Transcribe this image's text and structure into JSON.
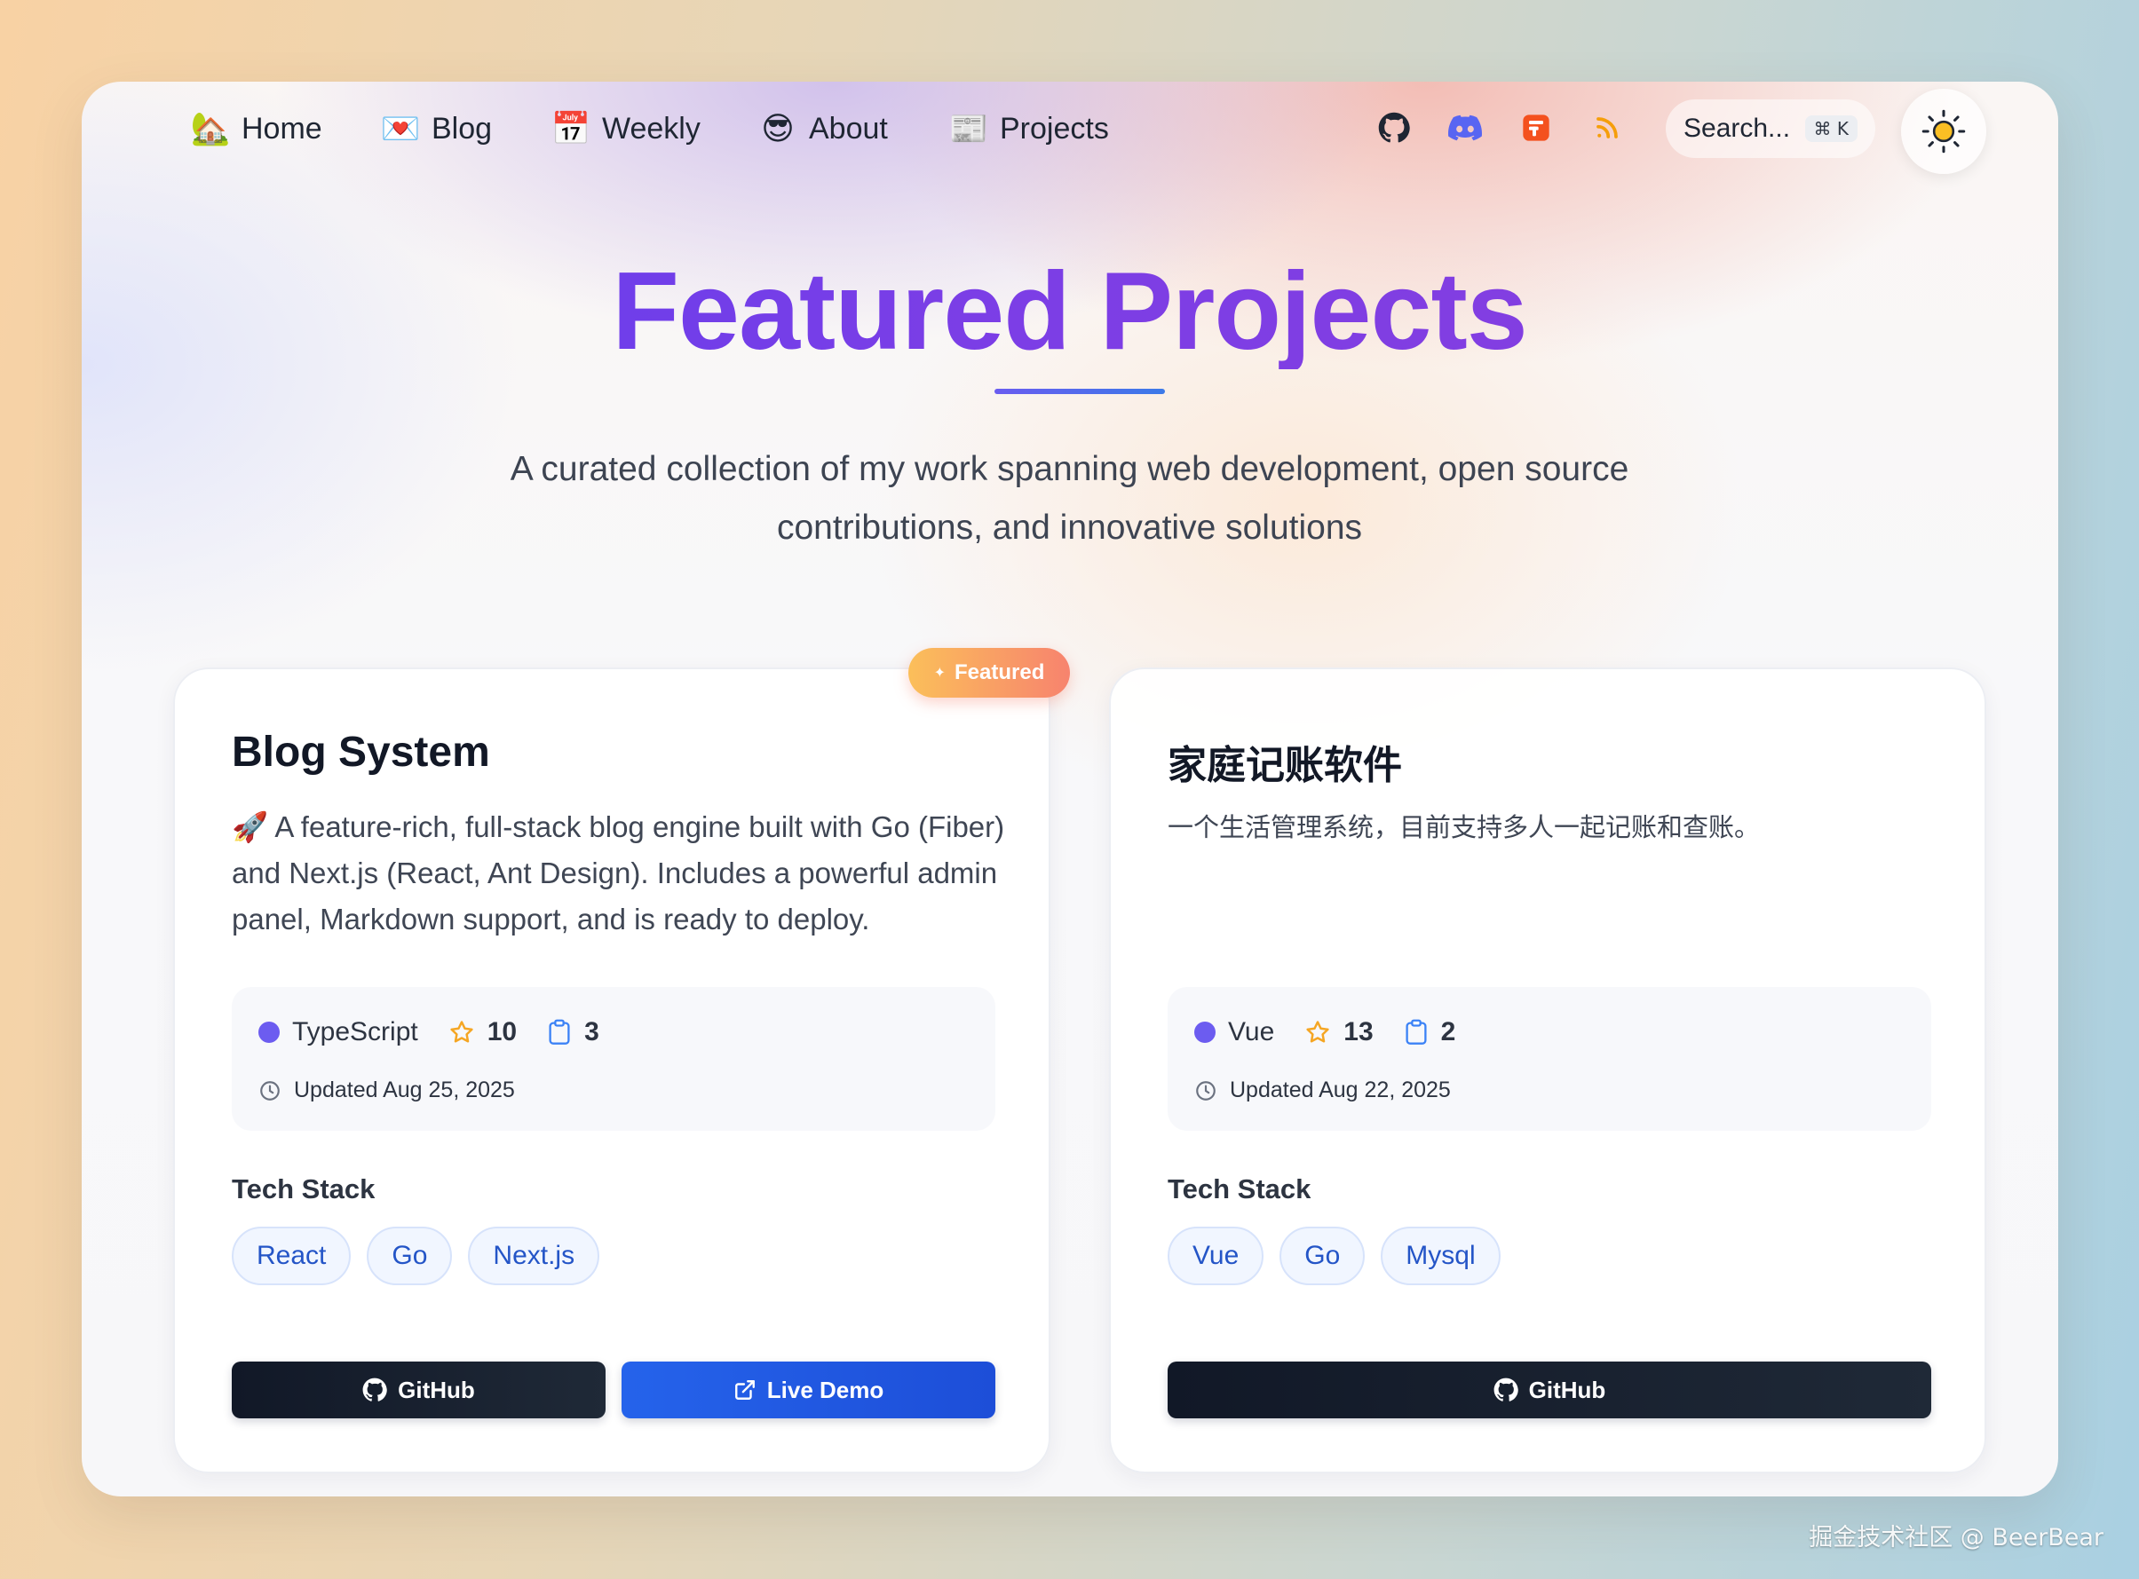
{
  "nav": {
    "items": [
      {
        "emoji": "🏡",
        "label": "Home",
        "icon": "house-icon"
      },
      {
        "emoji": "💌",
        "label": "Blog",
        "icon": "love-letter-icon"
      },
      {
        "emoji": "📅",
        "label": "Weekly",
        "icon": "calendar-icon"
      },
      {
        "emoji": "😎",
        "label": "About",
        "icon": "sunglasses-face-icon"
      },
      {
        "emoji": "📰",
        "label": "Projects",
        "icon": "newspaper-icon"
      }
    ],
    "social": [
      "github-icon",
      "discord-icon",
      "brand-icon",
      "rss-icon"
    ],
    "search_label": "Search...",
    "search_shortcut": "⌘ K",
    "theme_icon": "sun-icon"
  },
  "hero": {
    "title": "Featured Projects",
    "subtitle_line1": "A curated collection of my work spanning web development, open source",
    "subtitle_line2": "contributions, and innovative solutions"
  },
  "featured_badge": "Featured",
  "projects": [
    {
      "title": "Blog System",
      "description": "🚀 A feature-rich, full-stack blog engine built with Go (Fiber) and Next.js (React, Ant Design). Includes a powerful admin panel, Markdown support, and is ready to deploy.",
      "language": "TypeScript",
      "stars": "10",
      "forks": "3",
      "updated": "Updated Aug 25, 2025",
      "tech_label": "Tech Stack",
      "tags": [
        "React",
        "Go",
        "Next.js"
      ],
      "github_label": "GitHub",
      "demo_label": "Live Demo"
    },
    {
      "title": "家庭记账软件",
      "description": "一个生活管理系统，目前支持多人一起记账和查账。",
      "language": "Vue",
      "stars": "13",
      "forks": "2",
      "updated": "Updated Aug 22, 2025",
      "tech_label": "Tech Stack",
      "tags": [
        "Vue",
        "Go",
        "Mysql"
      ],
      "github_label": "GitHub"
    }
  ],
  "watermark": "掘金技术社区 @ BeerBear",
  "colors": {
    "accent": "#7b3ee6",
    "language_dot": "#6c5cf0",
    "star": "#f5a623",
    "primary_button": "#2563eb",
    "dark_button": "#111827"
  }
}
